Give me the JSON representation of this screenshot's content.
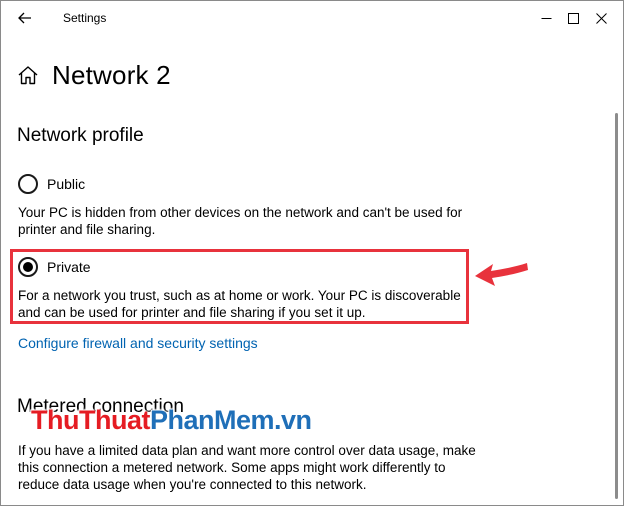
{
  "window": {
    "title": "Settings"
  },
  "page": {
    "title": "Network 2"
  },
  "network_profile": {
    "heading": "Network profile",
    "options": [
      {
        "label": "Public",
        "selected": false,
        "description": "Your PC is hidden from other devices on the network and can't be used for printer and file sharing."
      },
      {
        "label": "Private",
        "selected": true,
        "description": "For a network you trust, such as at home or work. Your PC is discoverable and can be used for printer and file sharing if you set it up."
      }
    ],
    "link": "Configure firewall and security settings"
  },
  "metered": {
    "heading": "Metered connection",
    "description": "If you have a limited data plan and want more control over data usage, make this connection a metered network. Some apps might work differently to reduce data usage when you're connected to this network."
  },
  "watermark": {
    "part1": "ThuThuat",
    "part2": "PhanMem",
    "part3": ".vn"
  },
  "colors": {
    "link": "#0063b1",
    "highlight": "#e8323c",
    "watermark_red": "#e51c23",
    "watermark_blue": "#1f6fb8"
  },
  "icons": {
    "back": "back-arrow-icon",
    "home": "home-icon",
    "minimize": "minimize-icon",
    "maximize": "maximize-icon",
    "close": "close-icon"
  }
}
